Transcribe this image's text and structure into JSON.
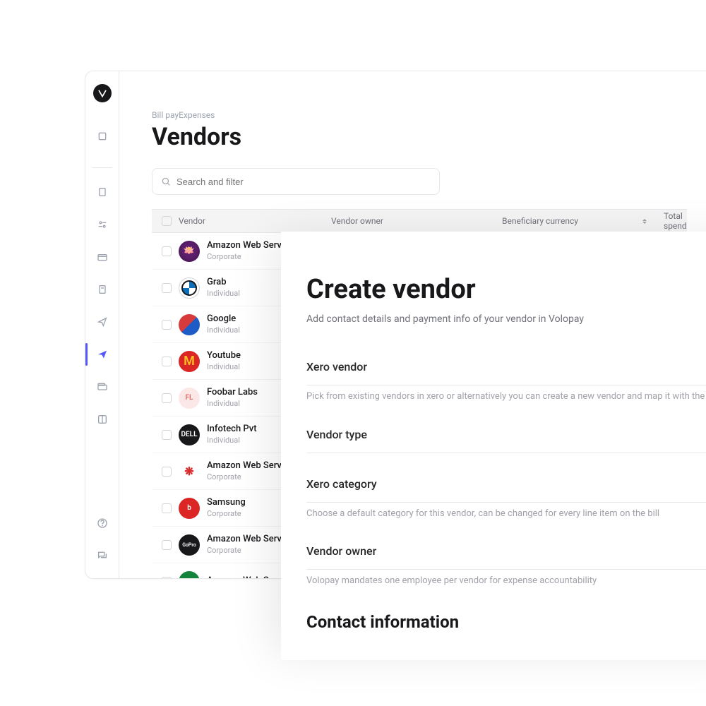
{
  "breadcrumb": "Bill payExpenses",
  "page_title": "Vendors",
  "search": {
    "placeholder": "Search and filter"
  },
  "table": {
    "columns": {
      "vendor": "Vendor",
      "owner": "Vendor owner",
      "currency": "Beneficiary currency",
      "spend": "Total spend"
    },
    "rows": [
      {
        "name": "Amazon Web Services",
        "type": "Corporate",
        "logo": "lg-aws"
      },
      {
        "name": "Grab",
        "type": "Individual",
        "logo": "lg-bmw"
      },
      {
        "name": "Google",
        "type": "Individual",
        "logo": "lg-google"
      },
      {
        "name": "Youtube",
        "type": "Individual",
        "logo": "lg-mcd",
        "glyph": "M"
      },
      {
        "name": "Foobar Labs",
        "type": "Individual",
        "logo": "lg-fl",
        "glyph": "FL"
      },
      {
        "name": "Infotech Pvt",
        "type": "Individual",
        "logo": "lg-dell",
        "glyph": "DELL"
      },
      {
        "name": "Amazon Web Services",
        "type": "Corporate",
        "logo": "lg-huawei",
        "glyph": "❋"
      },
      {
        "name": "Samsung",
        "type": "Corporate",
        "logo": "lg-beats",
        "glyph": "b"
      },
      {
        "name": "Amazon Web Services",
        "type": "Corporate",
        "logo": "lg-gopro",
        "glyph": "GoPro"
      },
      {
        "name": "Amazon Web Services",
        "type": "",
        "logo": "lg-green"
      }
    ]
  },
  "panel": {
    "title": "Create vendor",
    "subtitle": "Add contact details and payment info of your vendor in Volopay",
    "sections": {
      "xero_vendor": {
        "label": "Xero vendor",
        "desc": "Pick from existing vendors in xero or alternatively you can create a new vendor and map it with the"
      },
      "vendor_type": {
        "label": "Vendor type"
      },
      "xero_category": {
        "label": "Xero category",
        "desc": "Choose a default category for this vendor, can be changed for every line item on the bill"
      },
      "vendor_owner": {
        "label": "Vendor owner",
        "desc": "Volopay mandates one employee per vendor for expense accountability"
      },
      "contact": {
        "heading": "Contact information"
      }
    }
  }
}
